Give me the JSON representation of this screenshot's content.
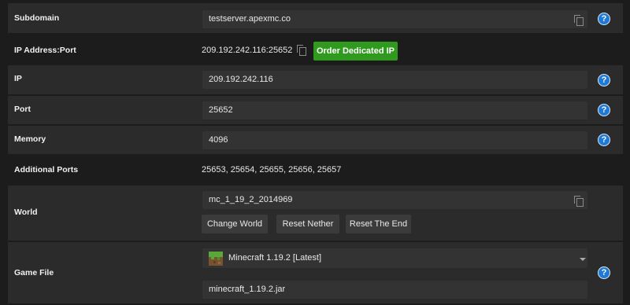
{
  "subdomain": {
    "label": "Subdomain",
    "value": "testserver.apexmc.co"
  },
  "ip_port": {
    "label": "IP Address:Port",
    "value": "209.192.242.116:25652",
    "order_button": "Order Dedicated IP"
  },
  "ip": {
    "label": "IP",
    "value": "209.192.242.116"
  },
  "port": {
    "label": "Port",
    "value": "25652"
  },
  "memory": {
    "label": "Memory",
    "value": "4096"
  },
  "additional_ports": {
    "label": "Additional Ports",
    "value": "25653, 25654, 25655, 25656, 25657"
  },
  "world": {
    "label": "World",
    "value": "mc_1_19_2_2014969",
    "buttons": [
      "Change World",
      "Reset Nether",
      "Reset The End"
    ]
  },
  "game_file": {
    "label": "Game File",
    "selected": "Minecraft 1.19.2 [Latest]",
    "jar": "minecraft_1.19.2.jar"
  },
  "help_glyph": "?",
  "colors": {
    "accent_green": "#2f9a1e",
    "help_blue": "#1e7ad6",
    "background": "#1c1c1c",
    "row_shade": "#2b2b2b",
    "field": "#333333"
  }
}
